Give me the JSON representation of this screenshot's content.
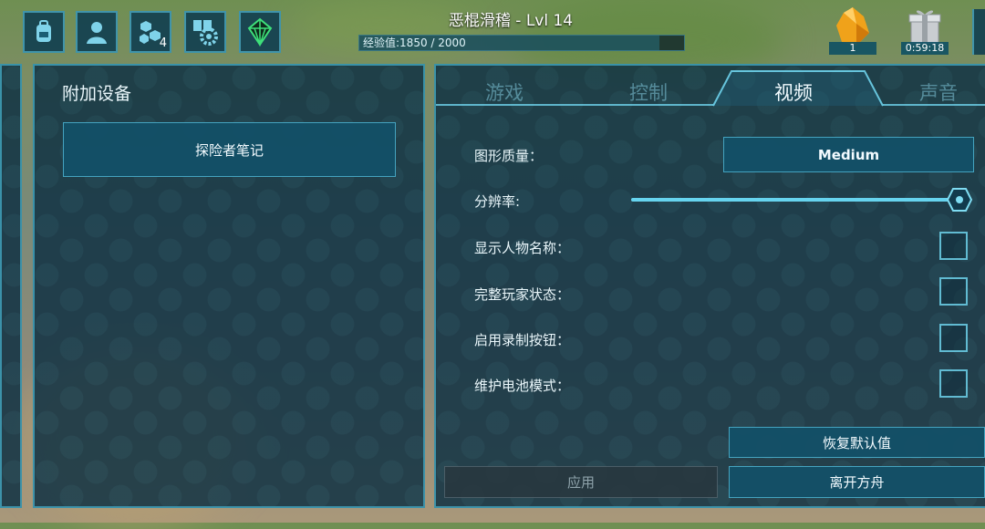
{
  "header": {
    "title": "恶棍滑稽 - Lvl 14",
    "xp_label": "经验值:1850 / 2000",
    "xp_progress": 0.925,
    "icons": [
      {
        "name": "inventory-backpack-icon"
      },
      {
        "name": "character-profile-icon"
      },
      {
        "name": "engrams-icon",
        "badge": "4"
      },
      {
        "name": "settings-gear-icon"
      },
      {
        "name": "tribe-crystal-icon"
      }
    ],
    "resource_count": "1",
    "gift_timer": "0:59:18"
  },
  "left_panel": {
    "heading": "附加设备",
    "item_button": "探险者笔记"
  },
  "tabs": [
    {
      "label": "游戏",
      "active": false
    },
    {
      "label": "控制",
      "active": false
    },
    {
      "label": "视频",
      "active": true
    },
    {
      "label": "声音",
      "active": false
    }
  ],
  "settings": {
    "graphics_quality_label": "图形质量：",
    "graphics_quality_value": "Medium",
    "resolution_label": "分辨率:",
    "resolution_value": 1.0,
    "show_names_label": "显示人物名称：",
    "full_player_status_label": "完整玩家状态：",
    "record_button_label": "启用录制按钮：",
    "battery_mode_label": "维护电池模式："
  },
  "buttons": {
    "apply": "应用",
    "reset_defaults": "恢复默认值",
    "leave_ark": "离开方舟"
  },
  "colors": {
    "accent": "#4fc3e0",
    "panel": "#103244"
  }
}
